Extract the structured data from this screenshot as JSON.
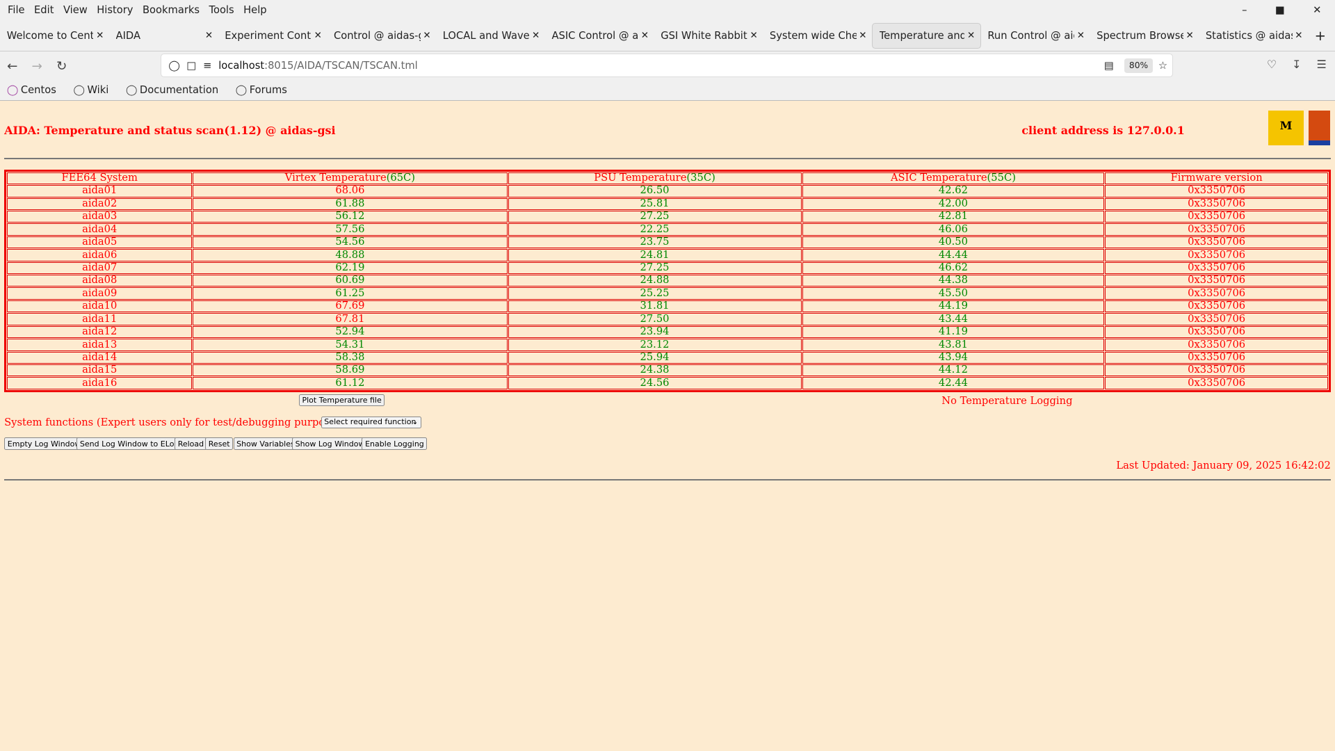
{
  "menu": [
    "File",
    "Edit",
    "View",
    "History",
    "Bookmarks",
    "Tools",
    "Help"
  ],
  "tabs": [
    {
      "label": "Welcome to CentOS"
    },
    {
      "label": "AIDA"
    },
    {
      "label": "Experiment Control"
    },
    {
      "label": "Control @ aidas-gsi"
    },
    {
      "label": "LOCAL and Waveform"
    },
    {
      "label": "ASIC Control @ aidas"
    },
    {
      "label": "GSI White Rabbit T"
    },
    {
      "label": "System wide Checks"
    },
    {
      "label": "Temperature and status",
      "active": true
    },
    {
      "label": "Run Control @ aidas"
    },
    {
      "label": "Spectrum Browser"
    },
    {
      "label": "Statistics @ aidas-gsi"
    }
  ],
  "url": {
    "host": "localhost",
    "path": ":8015/AIDA/TSCAN/TSCAN.tml",
    "zoom": "80%"
  },
  "bookmarks": [
    "Centos",
    "Wiki",
    "Documentation",
    "Forums"
  ],
  "page": {
    "title": "AIDA: Temperature and status scan(1.12) @ aidas-gsi",
    "client": "client address is 127.0.0.1",
    "logo_text": "Midas",
    "headers": {
      "sys": "FEE64 System",
      "virtex": "Virtex Temperature",
      "virtex_lim": "(65C)",
      "psu": "PSU Temperature",
      "psu_lim": "(35C)",
      "asic": "ASIC Temperature",
      "asic_lim": "(55C)",
      "fw": "Firmware version"
    },
    "rows": [
      [
        "aida01",
        "68.06",
        "26.50",
        "42.62",
        "0x3350706"
      ],
      [
        "aida02",
        "61.88",
        "25.81",
        "42.00",
        "0x3350706"
      ],
      [
        "aida03",
        "56.12",
        "27.25",
        "42.81",
        "0x3350706"
      ],
      [
        "aida04",
        "57.56",
        "22.25",
        "46.06",
        "0x3350706"
      ],
      [
        "aida05",
        "54.56",
        "23.75",
        "40.50",
        "0x3350706"
      ],
      [
        "aida06",
        "48.88",
        "24.81",
        "44.44",
        "0x3350706"
      ],
      [
        "aida07",
        "62.19",
        "27.25",
        "46.62",
        "0x3350706"
      ],
      [
        "aida08",
        "60.69",
        "24.88",
        "44.38",
        "0x3350706"
      ],
      [
        "aida09",
        "61.25",
        "25.25",
        "45.50",
        "0x3350706"
      ],
      [
        "aida10",
        "67.69",
        "31.81",
        "44.19",
        "0x3350706"
      ],
      [
        "aida11",
        "67.81",
        "27.50",
        "43.44",
        "0x3350706"
      ],
      [
        "aida12",
        "52.94",
        "23.94",
        "41.19",
        "0x3350706"
      ],
      [
        "aida13",
        "54.31",
        "23.12",
        "43.81",
        "0x3350706"
      ],
      [
        "aida14",
        "58.38",
        "25.94",
        "43.94",
        "0x3350706"
      ],
      [
        "aida15",
        "58.69",
        "24.38",
        "44.12",
        "0x3350706"
      ],
      [
        "aida16",
        "61.12",
        "24.56",
        "42.44",
        "0x3350706"
      ]
    ],
    "plot_button": "Plot Temperature file",
    "logging_status": "No Temperature Logging",
    "sysfunc_label": "System functions (Expert users only for test/debugging purposes!!!)",
    "sysfunc_select": "Select required function",
    "buttons": [
      "Empty Log Window",
      "Send Log Window to ELog",
      "Reload",
      "Reset",
      "Show Variables",
      "Show Log Window",
      "Enable Logging"
    ],
    "last_updated": "Last Updated: January 09, 2025 16:42:02"
  },
  "colors": {
    "ok": "#008800",
    "alarm": "#ff0000",
    "background": "#fdebd0"
  }
}
